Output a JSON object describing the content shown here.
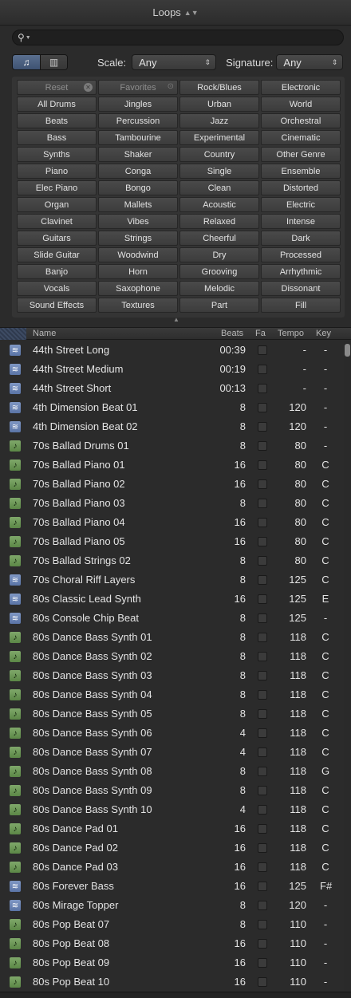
{
  "title": "Loops",
  "search": {
    "value": "",
    "placeholder": ""
  },
  "mode": {
    "audio_icon": "music-note-icon",
    "columns_icon": "columns-icon"
  },
  "scale": {
    "label": "Scale:",
    "value": "Any"
  },
  "signature": {
    "label": "Signature:",
    "value": "Any"
  },
  "keywords": [
    "Reset",
    "Favorites",
    "Rock/Blues",
    "Electronic",
    "All Drums",
    "Jingles",
    "Urban",
    "World",
    "Beats",
    "Percussion",
    "Jazz",
    "Orchestral",
    "Bass",
    "Tambourine",
    "Experimental",
    "Cinematic",
    "Synths",
    "Shaker",
    "Country",
    "Other Genre",
    "Piano",
    "Conga",
    "Single",
    "Ensemble",
    "Elec Piano",
    "Bongo",
    "Clean",
    "Distorted",
    "Organ",
    "Mallets",
    "Acoustic",
    "Electric",
    "Clavinet",
    "Vibes",
    "Relaxed",
    "Intense",
    "Guitars",
    "Strings",
    "Cheerful",
    "Dark",
    "Slide Guitar",
    "Woodwind",
    "Dry",
    "Processed",
    "Banjo",
    "Horn",
    "Grooving",
    "Arrhythmic",
    "Vocals",
    "Saxophone",
    "Melodic",
    "Dissonant",
    "Sound Effects",
    "Textures",
    "Part",
    "Fill"
  ],
  "columns": {
    "name": "Name",
    "beats": "Beats",
    "fav": "Fa",
    "tempo": "Tempo",
    "key": "Key"
  },
  "rows": [
    {
      "type": "audio",
      "name": "44th Street Long",
      "beats": "00:39",
      "tempo": "-",
      "key": "-"
    },
    {
      "type": "audio",
      "name": "44th Street Medium",
      "beats": "00:19",
      "tempo": "-",
      "key": "-"
    },
    {
      "type": "audio",
      "name": "44th Street Short",
      "beats": "00:13",
      "tempo": "-",
      "key": "-"
    },
    {
      "type": "audio",
      "name": "4th Dimension Beat 01",
      "beats": "8",
      "tempo": "120",
      "key": "-"
    },
    {
      "type": "audio",
      "name": "4th Dimension Beat 02",
      "beats": "8",
      "tempo": "120",
      "key": "-"
    },
    {
      "type": "midi",
      "name": "70s Ballad Drums 01",
      "beats": "8",
      "tempo": "80",
      "key": "-"
    },
    {
      "type": "midi",
      "name": "70s Ballad Piano 01",
      "beats": "16",
      "tempo": "80",
      "key": "C"
    },
    {
      "type": "midi",
      "name": "70s Ballad Piano 02",
      "beats": "16",
      "tempo": "80",
      "key": "C"
    },
    {
      "type": "midi",
      "name": "70s Ballad Piano 03",
      "beats": "8",
      "tempo": "80",
      "key": "C"
    },
    {
      "type": "midi",
      "name": "70s Ballad Piano 04",
      "beats": "16",
      "tempo": "80",
      "key": "C"
    },
    {
      "type": "midi",
      "name": "70s Ballad Piano 05",
      "beats": "16",
      "tempo": "80",
      "key": "C"
    },
    {
      "type": "midi",
      "name": "70s Ballad Strings 02",
      "beats": "8",
      "tempo": "80",
      "key": "C"
    },
    {
      "type": "audio",
      "name": "70s Choral Riff Layers",
      "beats": "8",
      "tempo": "125",
      "key": "C"
    },
    {
      "type": "audio",
      "name": "80s Classic Lead Synth",
      "beats": "16",
      "tempo": "125",
      "key": "E"
    },
    {
      "type": "audio",
      "name": "80s Console Chip Beat",
      "beats": "8",
      "tempo": "125",
      "key": "-"
    },
    {
      "type": "midi",
      "name": "80s Dance Bass Synth 01",
      "beats": "8",
      "tempo": "118",
      "key": "C"
    },
    {
      "type": "midi",
      "name": "80s Dance Bass Synth 02",
      "beats": "8",
      "tempo": "118",
      "key": "C"
    },
    {
      "type": "midi",
      "name": "80s Dance Bass Synth 03",
      "beats": "8",
      "tempo": "118",
      "key": "C"
    },
    {
      "type": "midi",
      "name": "80s Dance Bass Synth 04",
      "beats": "8",
      "tempo": "118",
      "key": "C"
    },
    {
      "type": "midi",
      "name": "80s Dance Bass Synth 05",
      "beats": "8",
      "tempo": "118",
      "key": "C"
    },
    {
      "type": "midi",
      "name": "80s Dance Bass Synth 06",
      "beats": "4",
      "tempo": "118",
      "key": "C"
    },
    {
      "type": "midi",
      "name": "80s Dance Bass Synth 07",
      "beats": "4",
      "tempo": "118",
      "key": "C"
    },
    {
      "type": "midi",
      "name": "80s Dance Bass Synth 08",
      "beats": "8",
      "tempo": "118",
      "key": "G"
    },
    {
      "type": "midi",
      "name": "80s Dance Bass Synth 09",
      "beats": "8",
      "tempo": "118",
      "key": "C"
    },
    {
      "type": "midi",
      "name": "80s Dance Bass Synth 10",
      "beats": "4",
      "tempo": "118",
      "key": "C"
    },
    {
      "type": "midi",
      "name": "80s Dance Pad 01",
      "beats": "16",
      "tempo": "118",
      "key": "C"
    },
    {
      "type": "midi",
      "name": "80s Dance Pad 02",
      "beats": "16",
      "tempo": "118",
      "key": "C"
    },
    {
      "type": "midi",
      "name": "80s Dance Pad 03",
      "beats": "16",
      "tempo": "118",
      "key": "C"
    },
    {
      "type": "audio",
      "name": "80s Forever Bass",
      "beats": "16",
      "tempo": "125",
      "key": "F#"
    },
    {
      "type": "audio",
      "name": "80s Mirage Topper",
      "beats": "8",
      "tempo": "120",
      "key": "-"
    },
    {
      "type": "midi",
      "name": "80s Pop Beat 07",
      "beats": "8",
      "tempo": "110",
      "key": "-"
    },
    {
      "type": "midi",
      "name": "80s Pop Beat 08",
      "beats": "16",
      "tempo": "110",
      "key": "-"
    },
    {
      "type": "midi",
      "name": "80s Pop Beat 09",
      "beats": "16",
      "tempo": "110",
      "key": "-"
    },
    {
      "type": "midi",
      "name": "80s Pop Beat 10",
      "beats": "16",
      "tempo": "110",
      "key": "-"
    }
  ]
}
